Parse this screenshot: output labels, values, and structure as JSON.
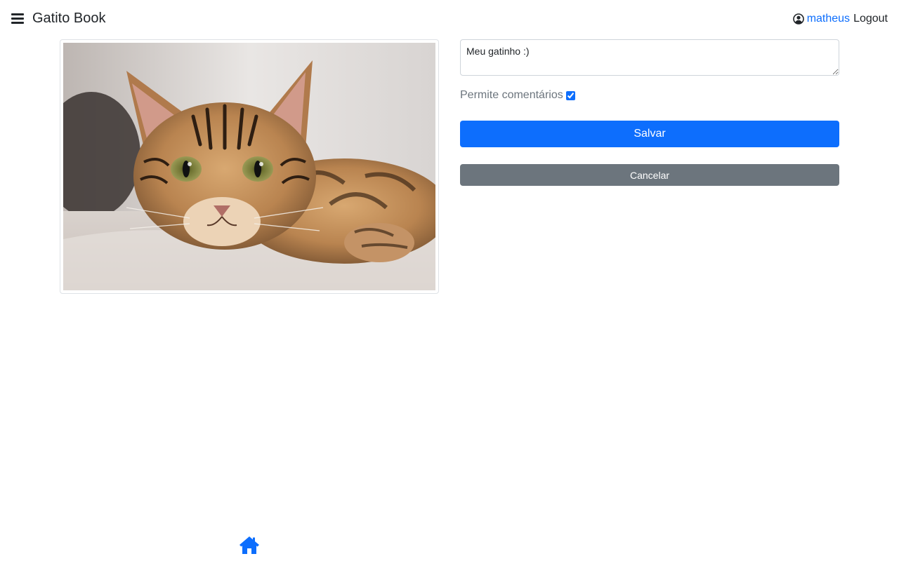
{
  "header": {
    "menu_icon": "bars-icon",
    "brand": "Gatito Book",
    "user_icon": "user-circle-icon",
    "username": "matheus",
    "logout_label": "Logout"
  },
  "photo": {
    "alt": "Foto de um gatinho"
  },
  "form": {
    "description_value": "Meu gatinho :)",
    "allow_comments_label": "Permite comentários",
    "allow_comments_checked": true,
    "save_label": "Salvar",
    "cancel_label": "Cancelar"
  },
  "footer": {
    "home_icon": "home-icon"
  },
  "colors": {
    "primary": "#0d6efd",
    "secondary": "#6c757d",
    "text": "#212529"
  }
}
